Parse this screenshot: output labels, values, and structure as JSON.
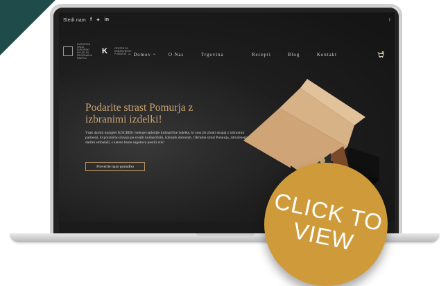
{
  "topbar": {
    "follow_text": "Sledi nam",
    "social_icons": [
      "facebook-icon",
      "twitter-icon",
      "linkedin-icon"
    ],
    "right_mark": "I"
  },
  "nav": {
    "items": [
      {
        "label": "~ Domov ~"
      },
      {
        "label": "O Nas"
      },
      {
        "label": "Trgovina"
      },
      {
        "label": "Recepti"
      },
      {
        "label": "Blog"
      },
      {
        "label": "Kontakt"
      }
    ],
    "cart_icon": "cart-icon",
    "cart_count": "0"
  },
  "hero": {
    "title": "Podarite strast Pomurja z izbranimi izdelki!",
    "description": "Vsak darilni komplet KOCBEK vsebuje najboljše kulinarične izdelke, ki smo jih zbrali skupaj z izbranimi partnerji, ki praznično slavijo po svojih kulinaričnih, izbranih dobrotah. Občutite strast Pomurja, združenega v darilni embalaži, s katero boste zagotovo pustili vtis!",
    "cta_label": "Preverite naso ponudbo"
  },
  "badge": {
    "text": "CLICK TO VIEW"
  },
  "colors": {
    "accent_gold": "#c9a273",
    "badge_orange": "#cf9b3a",
    "corner_teal": "#1f4c4b",
    "screen_bg": "#151515"
  }
}
